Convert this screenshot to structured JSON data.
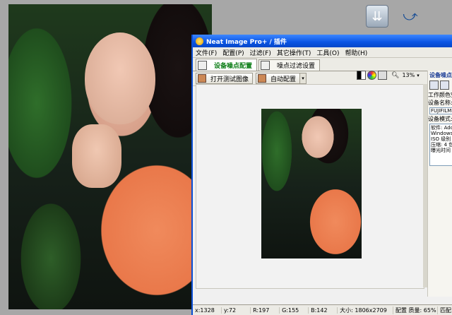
{
  "window": {
    "title": "Neat Image Pro+ / 插件"
  },
  "menu": [
    "文件(F)",
    "配置(P)",
    "过滤(F)",
    "其它操作(T)",
    "工具(O)",
    "帮助(H)"
  ],
  "tabs": [
    {
      "label": "设备噪点配置",
      "active": true
    },
    {
      "label": "噪点过滤设置",
      "active": false
    }
  ],
  "toolbar": {
    "open_test_image": "打开测试图像",
    "auto_profile": "自动配置",
    "zoom": "13%"
  },
  "side_panel": {
    "title": "设备噪点",
    "workspace_label": "工作颜色空",
    "device_name_label": "设备名称:",
    "device_name_value": "FUJIFILMF",
    "device_mode_label": "设备模式:",
    "info_lines": [
      "软件: Ado",
      "Windows",
      "ISO 级别",
      "压缩: 4 包",
      "曝光时间"
    ]
  },
  "status": {
    "x": "x:1328",
    "y": "y:72",
    "r": "R:197",
    "g": "G:155",
    "b": "B:142",
    "size": "大小: 1806x2709",
    "profile": "配置 质量: 65%",
    "tail": "匹配"
  },
  "colors": {
    "title_start": "#3d87ff",
    "title_end": "#0647c8",
    "active_tab_text": "#0b7d16"
  }
}
